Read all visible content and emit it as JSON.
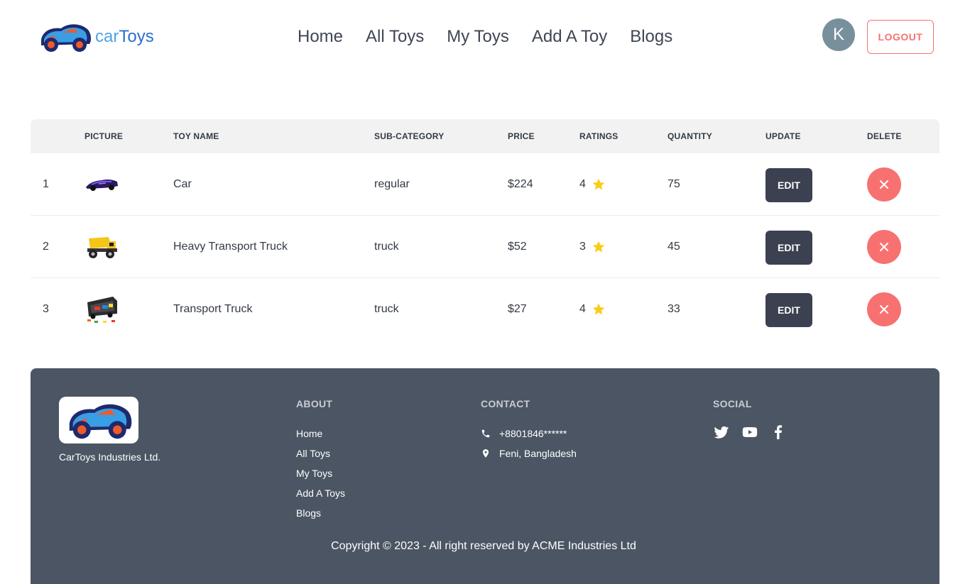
{
  "brand": {
    "text_part1": "car",
    "text_part2": "Toys"
  },
  "nav": {
    "items": [
      "Home",
      "All Toys",
      "My Toys",
      "Add A Toy",
      "Blogs"
    ]
  },
  "user": {
    "avatar_initial": "K",
    "logout_label": "LOGOUT"
  },
  "table": {
    "headers": [
      "PICTURE",
      "TOY NAME",
      "SUB-CATEGORY",
      "PRICE",
      "RATINGS",
      "QUANTITY",
      "UPDATE",
      "DELETE"
    ],
    "rows": [
      {
        "num": "1",
        "name": "Car",
        "subcategory": "regular",
        "price": "$224",
        "rating": "4",
        "quantity": "75",
        "edit_label": "EDIT",
        "picture_icon": "purple-sports-car"
      },
      {
        "num": "2",
        "name": "Heavy Transport Truck",
        "subcategory": "truck",
        "price": "$52",
        "rating": "3",
        "quantity": "45",
        "edit_label": "EDIT",
        "picture_icon": "yellow-dump-truck"
      },
      {
        "num": "3",
        "name": "Transport Truck",
        "subcategory": "truck",
        "price": "$27",
        "rating": "4",
        "quantity": "33",
        "edit_label": "EDIT",
        "picture_icon": "car-carrier-truck"
      }
    ]
  },
  "footer": {
    "company": "CarToys Industries Ltd.",
    "about": {
      "heading": "ABOUT",
      "links": [
        "Home",
        "All Toys",
        "My Toys",
        "Add A Toys",
        "Blogs"
      ]
    },
    "contact": {
      "heading": "CONTACT",
      "phone": "+8801846******",
      "location": "Feni, Bangladesh"
    },
    "social": {
      "heading": "SOCIAL",
      "icons": [
        "twitter-icon",
        "youtube-icon",
        "facebook-icon"
      ]
    },
    "copyright": "Copyright © 2023 - All right reserved by ACME Industries Ltd"
  },
  "colors": {
    "accent_red": "#f87171",
    "dark_button": "#3b4150",
    "footer_bg": "#4b5563",
    "star": "#facc15",
    "brand_blue": "#2d6fd0"
  }
}
